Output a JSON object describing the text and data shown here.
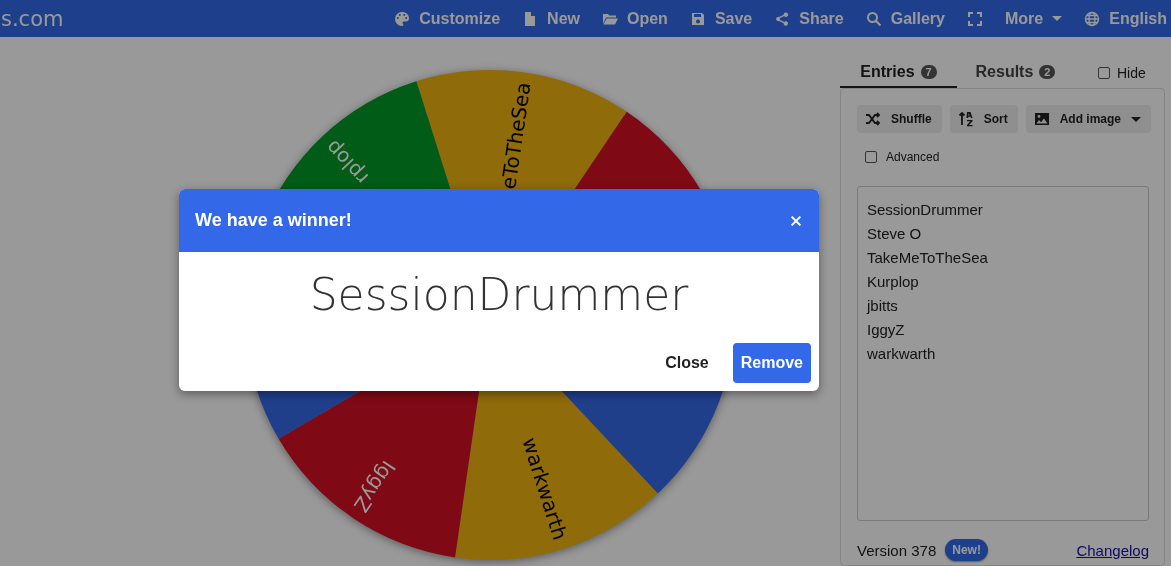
{
  "header": {
    "site": "s.com",
    "menu": [
      "Customize",
      "New",
      "Open",
      "Save",
      "Share",
      "Gallery"
    ],
    "more": "More",
    "language": "English"
  },
  "wheel": {
    "segments": [
      {
        "label": "eToTheSea",
        "color": "#8f6b0a"
      },
      {
        "color": "#800916"
      },
      {
        "color": "#1f3f8b"
      },
      {
        "label": "warkwarth",
        "color": "#8f6b0a"
      },
      {
        "label": "IggyZ",
        "color": "#800916"
      },
      {
        "color": "#1f3f8b"
      },
      {
        "label": "rplop",
        "color": "#005c16"
      }
    ]
  },
  "panel": {
    "tabs": [
      {
        "label": "Entries",
        "count": "7",
        "selected": true
      },
      {
        "label": "Results",
        "count": "2",
        "selected": false
      }
    ],
    "hide": {
      "label": "Hide",
      "checked": false
    },
    "tools": [
      {
        "label": "Shuffle"
      },
      {
        "label": "Sort"
      },
      {
        "label": "Add image",
        "dropdown": true
      }
    ],
    "advanced": {
      "label": "Advanced",
      "checked": false
    },
    "entries": [
      "SessionDrummer",
      "Steve O",
      "TakeMeToTheSea",
      "Kurplop",
      "jbitts",
      "IggyZ",
      "warkwarth"
    ],
    "version": "Version 378",
    "badge": "New!",
    "changelog": "Changelog"
  },
  "dialog": {
    "title": "We have a winner!",
    "winner": "SessionDrummer",
    "buttons": [
      {
        "label": "Close",
        "primary": false
      },
      {
        "label": "Remove",
        "primary": true
      }
    ]
  }
}
